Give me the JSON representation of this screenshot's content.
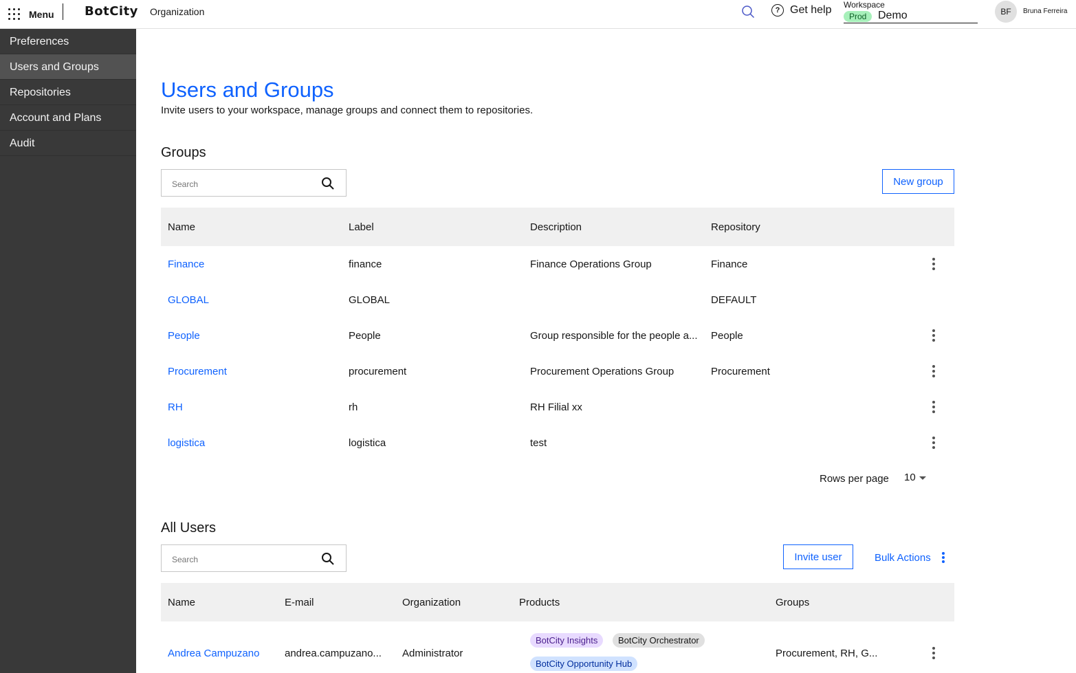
{
  "topbar": {
    "menu_label": "Menu",
    "logo": "BotCity",
    "section": "Organization",
    "help_label": "Get help",
    "workspace_label": "Workspace",
    "workspace_env": "Prod",
    "workspace_name": "Demo",
    "user_initials": "BF",
    "user_name": "Bruna Ferreira"
  },
  "sidebar": {
    "items": [
      {
        "label": "Preferences"
      },
      {
        "label": "Users and Groups"
      },
      {
        "label": "Repositories"
      },
      {
        "label": "Account and Plans"
      },
      {
        "label": "Audit"
      }
    ],
    "active": "Users and Groups"
  },
  "page": {
    "title": "Users and Groups",
    "description": "Invite users to your workspace, manage groups and connect them to repositories."
  },
  "groups": {
    "title": "Groups",
    "search_placeholder": "Search",
    "new_group_label": "New group",
    "columns": [
      "Name",
      "Label",
      "Description",
      "Repository"
    ],
    "rows": [
      {
        "name": "Finance",
        "label": "finance",
        "description": "Finance Operations Group",
        "repository": "Finance",
        "has_menu": true
      },
      {
        "name": "GLOBAL",
        "label": "GLOBAL",
        "description": "",
        "repository": "DEFAULT",
        "has_menu": false
      },
      {
        "name": "People",
        "label": "People",
        "description": "Group responsible for the people a...",
        "repository": "People",
        "has_menu": true
      },
      {
        "name": "Procurement",
        "label": "procurement",
        "description": "Procurement Operations Group",
        "repository": "Procurement",
        "has_menu": true
      },
      {
        "name": "RH",
        "label": "rh",
        "description": "RH Filial xx",
        "repository": "",
        "has_menu": true
      },
      {
        "name": "logistica",
        "label": "logistica",
        "description": "test",
        "repository": "",
        "has_menu": true
      }
    ],
    "rows_per_page_label": "Rows per page",
    "rows_per_page_value": "10"
  },
  "users": {
    "title": "All Users",
    "search_placeholder": "Search",
    "invite_label": "Invite user",
    "bulk_label": "Bulk Actions",
    "columns": [
      "Name",
      "E-mail",
      "Organization",
      "Products",
      "Groups"
    ],
    "rows": [
      {
        "name": "Andrea Campuzano",
        "email": "andrea.campuzano...",
        "organization": "Administrator",
        "products": [
          "BotCity Insights",
          "BotCity Orchestrator",
          "BotCity Opportunity Hub"
        ],
        "groups": "Procurement, RH, G..."
      }
    ]
  },
  "colors": {
    "accent": "#0f62fe",
    "sidebar_bg": "#393939",
    "sidebar_active": "#525252",
    "prod_badge_bg": "#a7f0ba",
    "tag_insights": "#e8daff",
    "tag_orchestrator": "#e0e0e0",
    "tag_hub": "#d0e2ff"
  }
}
